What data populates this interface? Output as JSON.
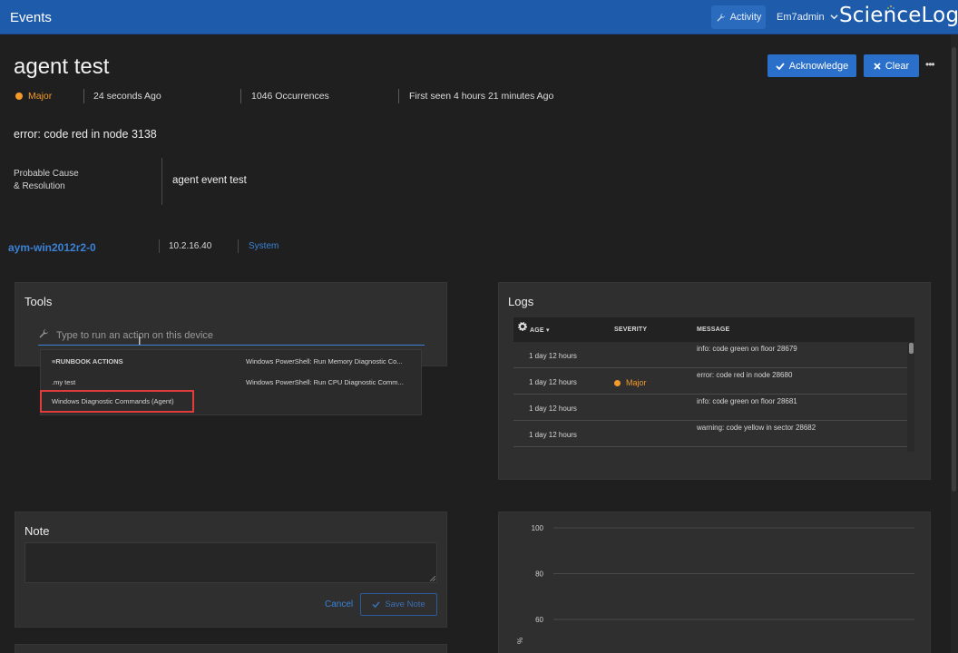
{
  "header": {
    "title": "Events",
    "activity_label": "Activity",
    "user_label": "Em7admin",
    "logo_text": "ScienceLogic"
  },
  "event": {
    "title": "agent test",
    "severity": "Major",
    "age": "24 seconds Ago",
    "occurrences": "1046 Occurrences",
    "first_seen": "First seen 4 hours 21 minutes Ago",
    "message": "error: code red in node 3138",
    "cause_label": "Probable Cause\n& Resolution",
    "cause_value": "agent event test"
  },
  "actions": {
    "acknowledge_label": "Acknowledge",
    "clear_label": "Clear",
    "more_label": "•••"
  },
  "device": {
    "name": "aym-win2012r2-0",
    "ip": "10.2.16.40",
    "org": "System"
  },
  "tools": {
    "title": "Tools",
    "search_placeholder": "Type to run an action on this device",
    "items": [
      {
        "label": "≡RUNBOOK ACTIONS"
      },
      {
        "label": "Windows PowerShell: Run Memory Diagnostic Co..."
      },
      {
        "label": ".my test"
      },
      {
        "label": "Windows PowerShell: Run CPU Diagnostic Comm..."
      },
      {
        "label": "Windows Diagnostic Commands (Agent)"
      }
    ]
  },
  "logs": {
    "title": "Logs",
    "columns": [
      "AGE",
      "SEVERITY",
      "MESSAGE"
    ],
    "rows": [
      {
        "age": "1 day 12 hours",
        "severity": "",
        "message": "info: code green on floor 28679"
      },
      {
        "age": "1 day 12 hours",
        "severity": "Major",
        "message": "error: code red in node 28680"
      },
      {
        "age": "1 day 12 hours",
        "severity": "",
        "message": "info: code green on floor 28681"
      },
      {
        "age": "1 day 12 hours",
        "severity": "",
        "message": "warning: code yellow in sector 28682"
      }
    ]
  },
  "note": {
    "title": "Note",
    "value": "",
    "cancel_label": "Cancel",
    "save_label": "Save Note"
  },
  "chart_data": {
    "type": "line",
    "ylabel": "%",
    "yticks": [
      100,
      80,
      60
    ],
    "series": []
  },
  "colors": {
    "header": "#1e5cab",
    "accent": "#2a6fc9",
    "link": "#3b82d6",
    "major": "#f39a2b",
    "highlight": "#e03c3c",
    "background": "#1f1f1f",
    "panel": "#2f2f2f"
  },
  "icons": {
    "activity": "wrench-icon",
    "user_menu": "chevron-down-icon",
    "acknowledge": "check-icon",
    "clear": "close-icon",
    "tools_search": "wrench-icon",
    "logs_settings": "gear-icon",
    "save_note": "check-icon"
  }
}
